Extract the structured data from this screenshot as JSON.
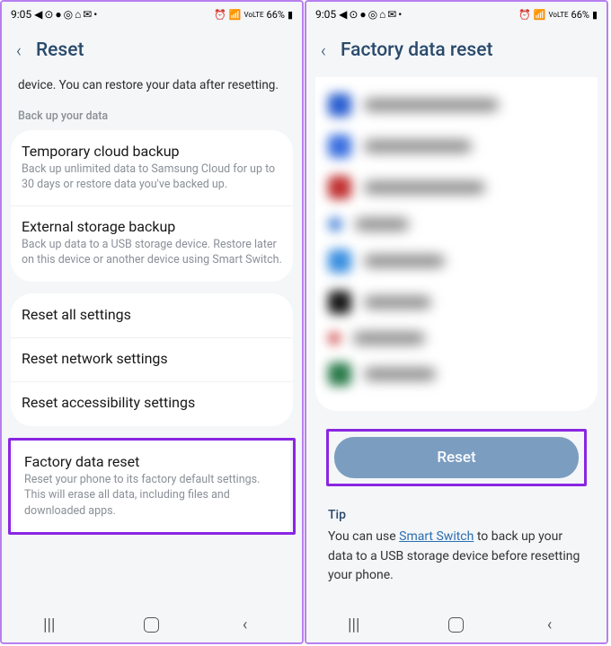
{
  "status": {
    "time": "9:05",
    "left_icons": "◀ ⊙ ● ◎ ⌂ ✉ •",
    "right_icons": "⏰ 📶",
    "network_label": "VoLTE",
    "battery": "66%"
  },
  "left": {
    "title": "Reset",
    "intro": "device. You can restore your data after resetting.",
    "section_backup": "Back up your data",
    "backup": [
      {
        "title": "Temporary cloud backup",
        "sub": "Back up unlimited data to Samsung Cloud for up to 30 days or restore data you've backed up."
      },
      {
        "title": "External storage backup",
        "sub": "Back up data to a USB storage device. Restore later on this device or another device using Smart Switch."
      }
    ],
    "resets": [
      {
        "title": "Reset all settings"
      },
      {
        "title": "Reset network settings"
      },
      {
        "title": "Reset accessibility settings"
      }
    ],
    "factory": {
      "title": "Factory data reset",
      "sub": "Reset your phone to its factory default settings. This will erase all data, including files and downloaded apps."
    }
  },
  "right": {
    "title": "Factory data reset",
    "reset_button": "Reset",
    "tip_heading": "Tip",
    "tip_prefix": "You can use ",
    "tip_link": "Smart Switch",
    "tip_suffix": " to back up your data to a USB storage device before resetting your phone."
  }
}
